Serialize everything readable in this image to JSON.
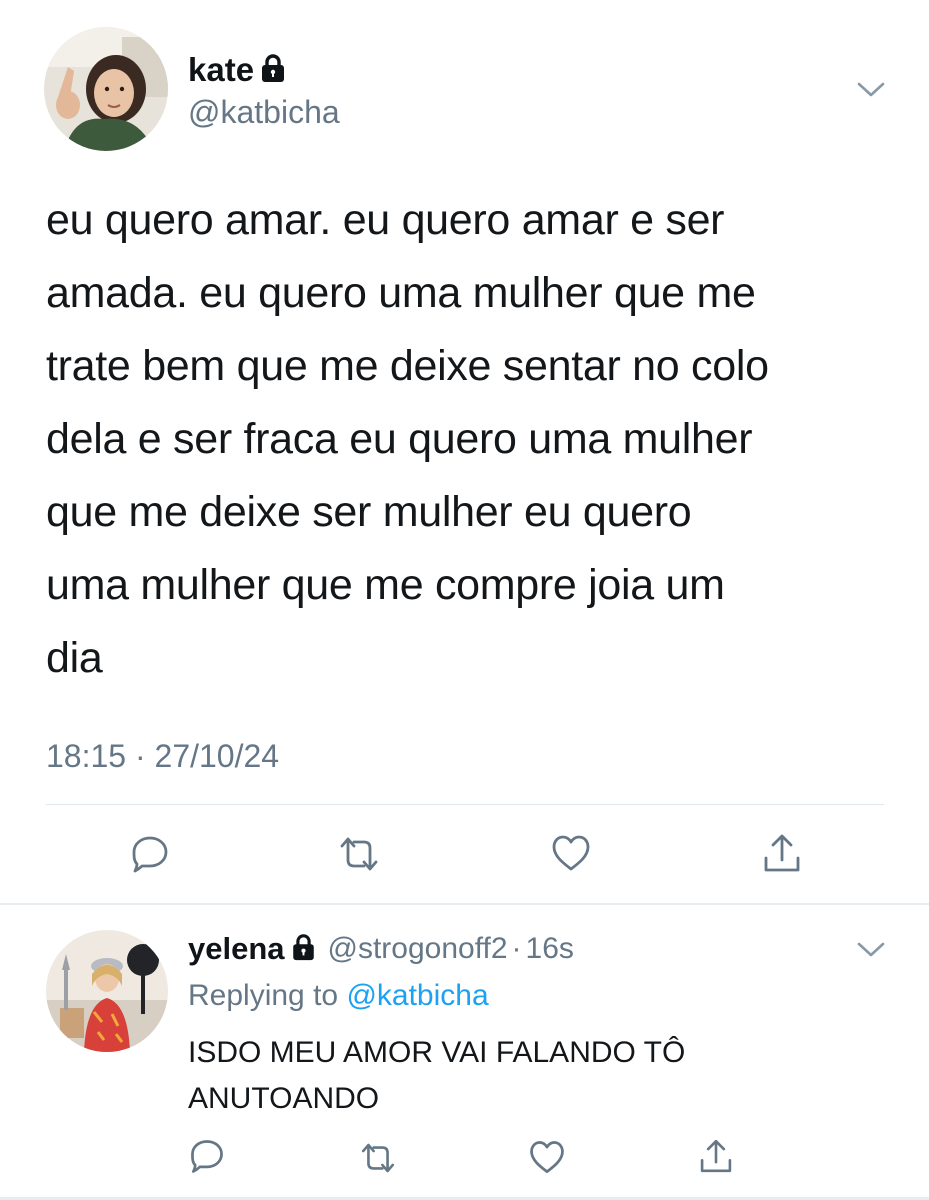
{
  "tweet": {
    "author": {
      "display_name": "kate",
      "handle": "@katbicha",
      "protected_icon": "lock-icon",
      "avatar_icon": "profile-photo"
    },
    "menu_icon": "chevron-down-icon",
    "text_lines": [
      "eu quero amar. eu quero amar e ser",
      "amada. eu quero uma mulher que me",
      "trate bem que me deixe sentar no colo",
      "dela e ser fraca eu quero uma mulher",
      "que me deixe ser mulher eu quero",
      "uma mulher que me compre joia um",
      "dia"
    ],
    "time": "18:15",
    "separator": "·",
    "date": "27/10/24",
    "actions": [
      "reply-icon",
      "retweet-icon",
      "like-icon",
      "share-icon"
    ]
  },
  "reply": {
    "author": {
      "display_name": "yelena",
      "handle": "@strogonoff2",
      "protected_icon": "lock-icon",
      "avatar_icon": "profile-photo"
    },
    "separator": "·",
    "age": "16s",
    "menu_icon": "chevron-down-icon",
    "replying_to_prefix": "Replying to",
    "replying_to_handle": "@katbicha",
    "text_lines": [
      "ISDO MEU AMOR VAI FALANDO TÔ",
      "ANUTOANDO"
    ],
    "actions": [
      "reply-icon",
      "retweet-icon",
      "like-icon",
      "share-icon"
    ]
  },
  "colors": {
    "text": "#14171a",
    "muted": "#657786",
    "link": "#1da1f2",
    "divider": "#e1e8ed"
  }
}
